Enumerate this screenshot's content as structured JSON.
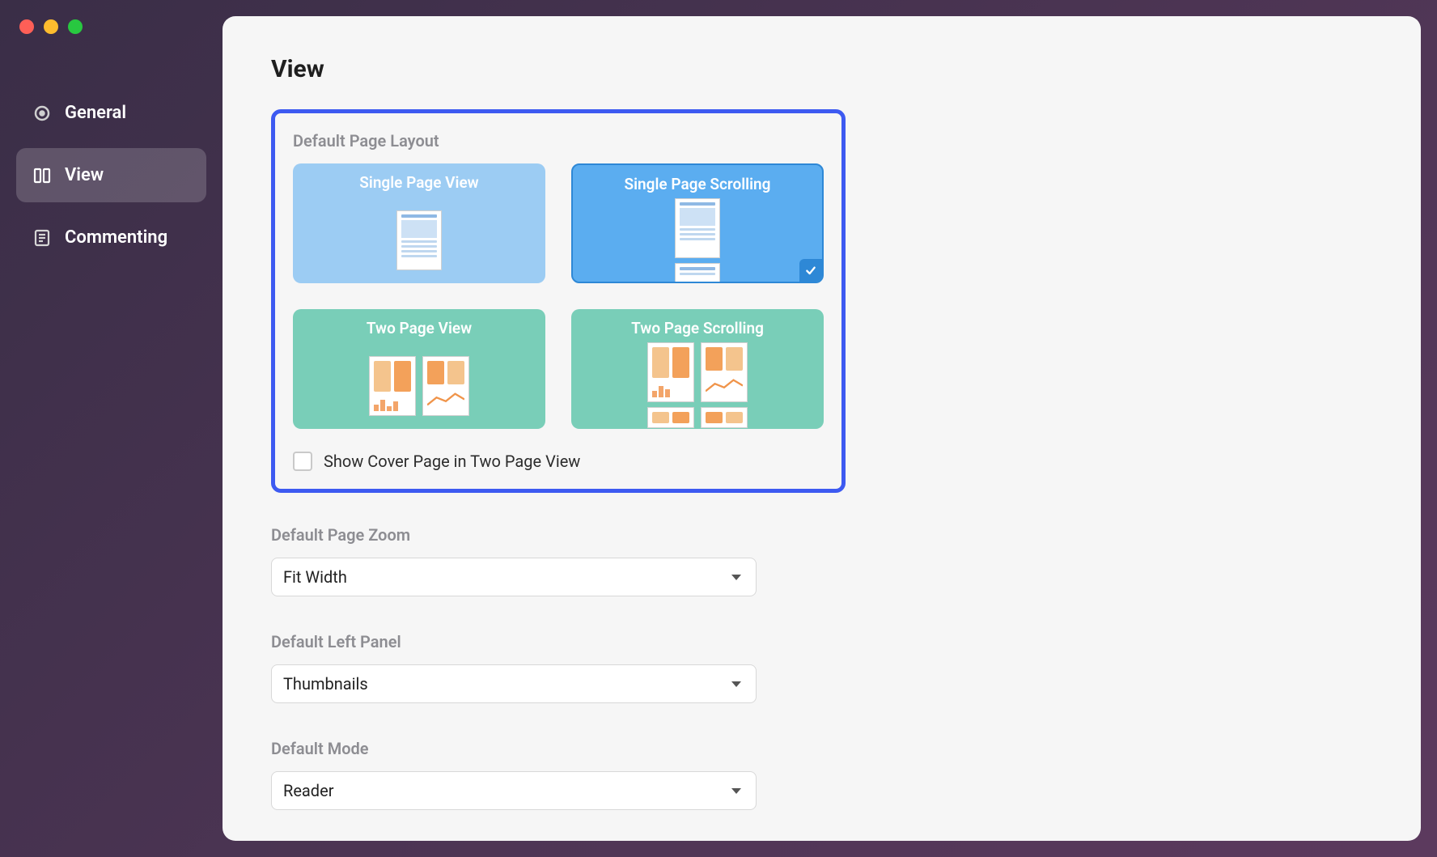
{
  "sidebar": {
    "items": [
      {
        "label": "General",
        "icon": "gear-icon",
        "selected": false
      },
      {
        "label": "View",
        "icon": "columns-icon",
        "selected": true
      },
      {
        "label": "Commenting",
        "icon": "note-icon",
        "selected": false
      }
    ]
  },
  "page": {
    "title": "View"
  },
  "layout_section": {
    "heading": "Default Page Layout",
    "options": {
      "single_view": "Single Page View",
      "single_scroll": "Single Page Scrolling",
      "two_view": "Two Page View",
      "two_scroll": "Two Page Scrolling"
    },
    "selected": "single_scroll",
    "cover_checkbox_label": "Show Cover Page in Two Page View",
    "cover_checkbox_checked": false
  },
  "zoom_section": {
    "heading": "Default Page Zoom",
    "value": "Fit Width"
  },
  "left_panel_section": {
    "heading": "Default Left Panel",
    "value": "Thumbnails"
  },
  "mode_section": {
    "heading": "Default Mode",
    "value": "Reader"
  }
}
